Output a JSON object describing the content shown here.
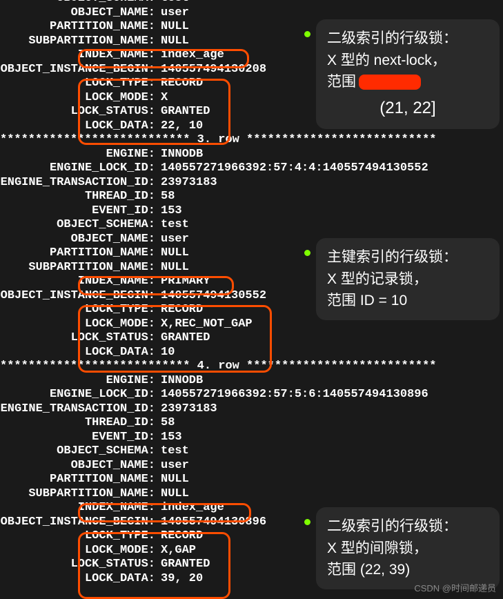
{
  "terminal": {
    "lines": [
      {
        "label": "OBJECT_SCHEMA:",
        "value": "test"
      },
      {
        "label": "OBJECT_NAME:",
        "value": "user"
      },
      {
        "label": "PARTITION_NAME:",
        "value": "NULL"
      },
      {
        "label": "SUBPARTITION_NAME:",
        "value": "NULL"
      },
      {
        "label": "INDEX_NAME:",
        "value": "index_age"
      },
      {
        "label": "OBJECT_INSTANCE_BEGIN:",
        "value": "140557494130208"
      },
      {
        "label": "LOCK_TYPE:",
        "value": "RECORD"
      },
      {
        "label": "LOCK_MODE:",
        "value": "X"
      },
      {
        "label": "LOCK_STATUS:",
        "value": "GRANTED"
      },
      {
        "label": "LOCK_DATA:",
        "value": "22, 10"
      },
      {
        "divider": "*************************** 3. row ***************************"
      },
      {
        "label": "ENGINE:",
        "value": "INNODB"
      },
      {
        "label": "ENGINE_LOCK_ID:",
        "value": "140557271966392:57:4:4:140557494130552"
      },
      {
        "label": "ENGINE_TRANSACTION_ID:",
        "value": "23973183"
      },
      {
        "label": "THREAD_ID:",
        "value": "58"
      },
      {
        "label": "EVENT_ID:",
        "value": "153"
      },
      {
        "label": "OBJECT_SCHEMA:",
        "value": "test"
      },
      {
        "label": "OBJECT_NAME:",
        "value": "user"
      },
      {
        "label": "PARTITION_NAME:",
        "value": "NULL"
      },
      {
        "label": "SUBPARTITION_NAME:",
        "value": "NULL"
      },
      {
        "label": "INDEX_NAME:",
        "value": "PRIMARY"
      },
      {
        "label": "OBJECT_INSTANCE_BEGIN:",
        "value": "140557494130552"
      },
      {
        "label": "LOCK_TYPE:",
        "value": "RECORD"
      },
      {
        "label": "LOCK_MODE:",
        "value": "X,REC_NOT_GAP"
      },
      {
        "label": "LOCK_STATUS:",
        "value": "GRANTED"
      },
      {
        "label": "LOCK_DATA:",
        "value": "10"
      },
      {
        "divider": "*************************** 4. row ***************************"
      },
      {
        "label": "ENGINE:",
        "value": "INNODB"
      },
      {
        "label": "ENGINE_LOCK_ID:",
        "value": "140557271966392:57:5:6:140557494130896"
      },
      {
        "label": "ENGINE_TRANSACTION_ID:",
        "value": "23973183"
      },
      {
        "label": "THREAD_ID:",
        "value": "58"
      },
      {
        "label": "EVENT_ID:",
        "value": "153"
      },
      {
        "label": "OBJECT_SCHEMA:",
        "value": "test"
      },
      {
        "label": "OBJECT_NAME:",
        "value": "user"
      },
      {
        "label": "PARTITION_NAME:",
        "value": "NULL"
      },
      {
        "label": "SUBPARTITION_NAME:",
        "value": "NULL"
      },
      {
        "label": "INDEX_NAME:",
        "value": "index_age"
      },
      {
        "label": "OBJECT_INSTANCE_BEGIN:",
        "value": "140557494130896"
      },
      {
        "label": "LOCK_TYPE:",
        "value": "RECORD"
      },
      {
        "label": "LOCK_MODE:",
        "value": "X,GAP"
      },
      {
        "label": "LOCK_STATUS:",
        "value": "GRANTED"
      },
      {
        "label": "LOCK_DATA:",
        "value": "39, 20"
      }
    ]
  },
  "notes": [
    {
      "id": "note1",
      "line1": "二级索引的行级锁：",
      "line2": "X 型的 next-lock，",
      "line3": "范围",
      "range": "(21, 22]"
    },
    {
      "id": "note2",
      "line1": "主键索引的行级锁：",
      "line2": "X 型的记录锁，",
      "line3": "范围 ID = 10"
    },
    {
      "id": "note3",
      "line1": "二级索引的行级锁：",
      "line2": "X 型的间隙锁，",
      "line3": "范围 (22, 39)"
    }
  ],
  "watermark": "CSDN @时间邮递员"
}
